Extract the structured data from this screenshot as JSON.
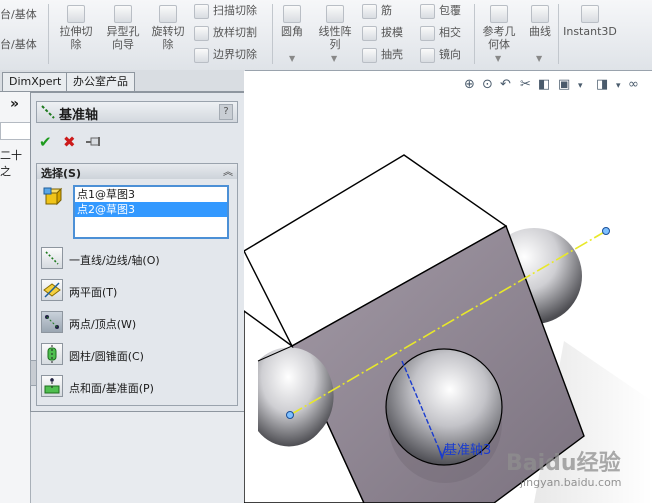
{
  "toolbar": {
    "left_cut": [
      "台/基体",
      "台/基体"
    ],
    "buttons": [
      {
        "label": "拉伸切\n除"
      },
      {
        "label": "异型孔\n向导"
      },
      {
        "label": "旋转切\n除"
      }
    ],
    "small_items_col1": [
      "扫描切除",
      "放样切割",
      "边界切除"
    ],
    "fillet": "圆角",
    "linear_pattern": "线性阵\n列",
    "small_items_col2": [
      "筋",
      "拔模",
      "抽壳"
    ],
    "small_items_col3": [
      "包覆",
      "相交",
      "镜向"
    ],
    "ref_geom": "参考几\n何体",
    "curves": "曲线",
    "instant3d": "Instant3D"
  },
  "tabs": [
    "DimXpert",
    "办公室产品"
  ],
  "left_strip": {
    "arrow": "»",
    "partial_text": "二十之"
  },
  "property_manager": {
    "title": "基准轴",
    "help": "?",
    "selection_header": "选择(S)",
    "selected_items": [
      {
        "text": "点1@草图3",
        "selected": false
      },
      {
        "text": "点2@草图3",
        "selected": true
      }
    ],
    "options": [
      {
        "label": "一直线/边线/轴(O)",
        "icon": "line-edge-axis-icon"
      },
      {
        "label": "两平面(T)",
        "icon": "two-planes-icon"
      },
      {
        "label": "两点/顶点(W)",
        "icon": "two-points-icon"
      },
      {
        "label": "圆柱/圆锥面(C)",
        "icon": "cylinder-cone-icon"
      },
      {
        "label": "点和面/基准面(P)",
        "icon": "point-plane-icon"
      }
    ]
  },
  "viewport": {
    "axis_label": "基准轴3",
    "watermark_text": "Baidu经验",
    "watermark_sub": "jingyan.baidu.com"
  },
  "colors": {
    "ok": "#1e9b1e",
    "cancel": "#cc1a1a",
    "selection": "#3399ff",
    "axis_line": "#e8e82a",
    "axis_label": "#1a3ccf"
  }
}
